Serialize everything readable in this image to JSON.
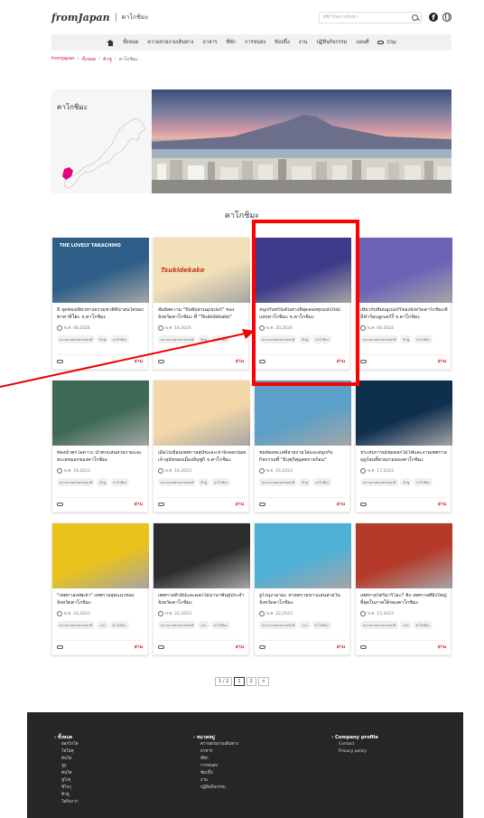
{
  "header": {
    "logo": "fromJapan",
    "area": "คาโกชิมะ",
    "search_placeholder": "คีย์เวิร์ดการค้นหา"
  },
  "nav": {
    "items": [
      "ทั้งหมด",
      "ความสวยงามเดินทาง",
      "อาหาร",
      "ที่พัก",
      "การขนส่ง",
      "ช้อปปิ้ง",
      "งาน",
      "ปฏิทินกิจกรรม",
      "แผนที่"
    ],
    "clip_label": "Clip"
  },
  "breadcrumb": [
    "fromJapan",
    "ทั้งหมด",
    "คิวชู",
    "คาโกชิมะ"
  ],
  "hero": {
    "title": "คาโกชิมะ"
  },
  "section_title": "คาโกชิมะ",
  "cards": [
    {
      "title": "8 จุดท่องเที่ยวทางธรรมชาติที่น่าสนใจของทาคาชิโฮะ จ.คาโกชิมะ",
      "date": "พ.ค. 06,2024",
      "tags": [
        "ความงามทางธรรมชาติ",
        "คิวชู",
        "คาโกชิมะ"
      ],
      "more": "อ่าน",
      "img_text": "THE LOVELY TAKACHIHO",
      "color": "#2f5f88"
    },
    {
      "title": "สัมผัสความ \"ปั่นซิ่งสวนอุปเปอร์\" ของจังหวัดคาโกชิมะ ที่ \"Tsukidekake\"",
      "date": "พ.ค. 16,2024",
      "tags": [
        "ความงามทางธรรมชาติ",
        "คิวชู",
        "คาโกชิมะ"
      ],
      "more": "อ่าน",
      "img_text": "Tsukidekake",
      "color": "#f1e0b8"
    },
    {
      "title": "สนุกกับทริปเดินทางที่สุดลอยทุกแห่งใหม่ แห่งคาโกชิมะ จ.คาโกชิมะ",
      "date": "พ.ค. 20,2024",
      "tags": [
        "ความงามทางธรรมชาติ",
        "คิวชู",
        "คาโกชิมะ"
      ],
      "more": "อ่าน",
      "img_text": "",
      "color": "#3e3b8a"
    },
    {
      "title": "เที่ยวกับทีมบลูเบอร์รี่ของจังหวัดคาโกชิมะที่มีฟาร์มบลูเบอร์รี่ จ.คาโกชิมะ",
      "date": "พ.ค. 06,2024",
      "tags": [
        "ความงามทางธรรมชาติ",
        "คิวชู",
        "คาโกชิมะ"
      ],
      "more": "อ่าน",
      "img_text": "",
      "color": "#6a63b6"
    },
    {
      "title": "ท่องน้ำตกโอคาวะ น้ำตกแสนสวยงามและทะเลหมอกของคาโกชิมะ",
      "date": "พ.ค. 16,2023",
      "tags": [
        "ความงามทางธรรมชาติ",
        "คิวชู",
        "คาโกชิมะ"
      ],
      "more": "อ่าน",
      "img_text": "",
      "color": "#3e6a55"
    },
    {
      "title": "เมื่อไปเยือนเทศกาลสุนัขและเจ้าจิ้งจอกน้อย เจ้าสุนัขของเมืองอิบุซูกิ จ.คาโกชิมะ",
      "date": "พ.ค. 16,2023",
      "tags": [
        "ความงามทางธรรมชาติ",
        "คิวชู",
        "คาโกชิมะ"
      ],
      "more": "อ่าน",
      "img_text": "",
      "color": "#f3d7a8"
    },
    {
      "title": "ชมท้องทะเลที่สวยงามใสและสนุกกับกิจกรรมที่ \"อิบุซุกิคุ่มุดทรายร้อน\"",
      "date": "พ.ค. 16,2023",
      "tags": [
        "ความงามทางธรรมชาติ",
        "คิวชู",
        "คาโกชิมะ"
      ],
      "more": "อ่าน",
      "img_text": "",
      "color": "#5aa0c8"
    },
    {
      "title": "ประสบการณ์ชมดอกไม้ไฟและงานเทศกาลฤดูร้อนที่สวยงามของคาโกชิมะ",
      "date": "พ.ค. 17,2023",
      "tags": [
        "ความงามทางธรรมชาติ",
        "คิวชู",
        "คาโกชิมะ"
      ],
      "more": "อ่าน",
      "img_text": "",
      "color": "#0e2f4e"
    },
    {
      "title": "\"เทศกาลเทพเจ้า\" เทศกาลสุดแนวของจังหวัดคาโกชิมะ",
      "date": "พ.ค. 16,2023",
      "tags": [
        "ความงามทางธรรมชาติ",
        "งาน",
        "คาโกชิมะ"
      ],
      "more": "อ่าน",
      "img_text": "",
      "color": "#e9c21b"
    },
    {
      "title": "เทศกาลทิวลิปและดอกไม้นานาพันธุ์ประจำจังหวัดคาโกชิมะ",
      "date": "พ.ค. 22,2023",
      "tags": [
        "ความงามทางธรรมชาติ",
        "งาน",
        "คาโกชิมะ"
      ],
      "more": "อ่าน",
      "img_text": "",
      "color": "#2c2c2c"
    },
    {
      "title": "ยูโรนุงาอามะ หาดทรายขาวแสนสวยในจังหวัดคาโกชิมะ",
      "date": "พ.ค. 22,2023",
      "tags": [
        "ความงามทางธรรมชาติ",
        "งาน",
        "คาโกชิมะ"
      ],
      "more": "อ่าน",
      "img_text": "",
      "color": "#4fb0d6"
    },
    {
      "title": "เทศกาลโทริมาริโอะ? ชิง เทศกาลที่ยิ่งใหญ่ที่สุดในภาคใต้ของคาโกชิมะ",
      "date": "พ.ค. 15,2023",
      "tags": [
        "ความงามทางธรรมชาติ",
        "งาน",
        "คาโกชิมะ"
      ],
      "more": "อ่าน",
      "img_text": "",
      "color": "#b53a2a"
    }
  ],
  "pagination": [
    "1 / 2",
    "1",
    "2",
    ">"
  ],
  "footer": {
    "col1_head": "ทั้งหมด",
    "col1_items": [
      "ฮอกไกโด",
      "โทโฮคุ",
      "คันโต",
      "จูบุ",
      "คันไซ",
      "ชูโงกุ",
      "ชิโกกุ",
      "คิวชู",
      "โอกินาว่า"
    ],
    "col2_head": "หมวดหมู่",
    "col2_items": [
      "ความสวยงามเดินทาง",
      "อาหาร",
      "ที่พัก",
      "การขนส่ง",
      "ช้อปปิ้ง",
      "งาน",
      "ปฏิทินกิจกรรม"
    ],
    "col3_head": "Company profile",
    "col3_items": [
      "Contact",
      "Privacy policy"
    ]
  }
}
